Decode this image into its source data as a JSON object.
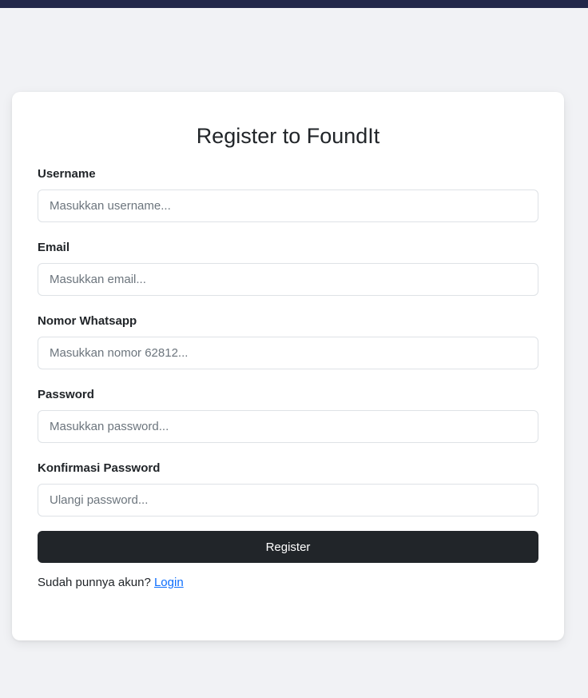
{
  "form": {
    "title": "Register to FoundIt",
    "fields": [
      {
        "label": "Username",
        "placeholder": "Masukkan username...",
        "value": ""
      },
      {
        "label": "Email",
        "placeholder": "Masukkan email...",
        "value": ""
      },
      {
        "label": "Nomor Whatsapp",
        "placeholder": "Masukkan nomor 62812...",
        "value": ""
      },
      {
        "label": "Password",
        "placeholder": "Masukkan password...",
        "value": ""
      },
      {
        "label": "Konfirmasi Password",
        "placeholder": "Ulangi password...",
        "value": ""
      }
    ],
    "submit_label": "Register",
    "login_prompt": "Sudah punnya akun?",
    "login_link": "Login"
  },
  "colors": {
    "topbar": "#23284a",
    "background": "#f1f2f5",
    "button": "#212529",
    "link": "#0d6efd"
  }
}
